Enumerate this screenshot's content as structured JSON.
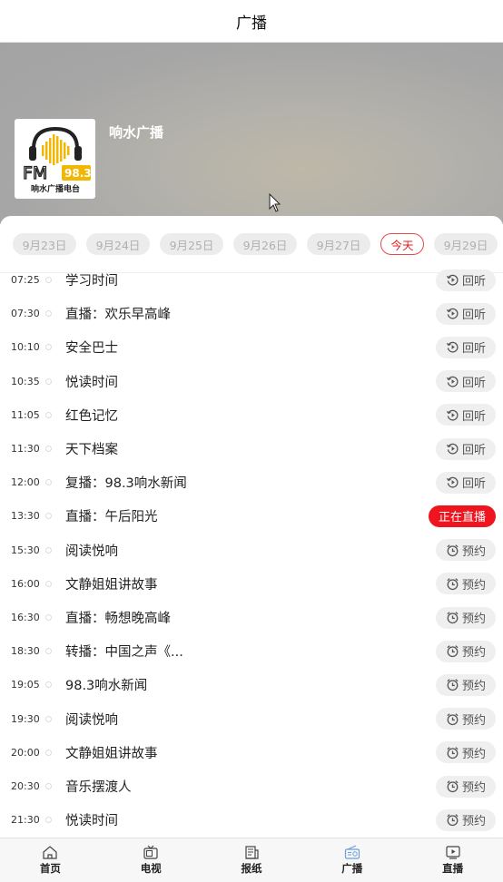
{
  "header": {
    "title": "广播"
  },
  "station": {
    "name": "响水广播",
    "logo_text_fm": "FM",
    "logo_text_freq": "98.3",
    "logo_text_caption": "响水广播电台"
  },
  "dates": [
    {
      "label": "9月23日",
      "active": false
    },
    {
      "label": "9月24日",
      "active": false
    },
    {
      "label": "9月25日",
      "active": false
    },
    {
      "label": "9月26日",
      "active": false
    },
    {
      "label": "9月27日",
      "active": false
    },
    {
      "label": "今天",
      "active": true
    },
    {
      "label": "9月29日",
      "active": false
    }
  ],
  "schedule": [
    {
      "time": "07:25",
      "name": "学习时间",
      "action": "回听",
      "type": "replay"
    },
    {
      "time": "07:30",
      "name": "直播：欢乐早高峰",
      "action": "回听",
      "type": "replay"
    },
    {
      "time": "10:10",
      "name": "安全巴士",
      "action": "回听",
      "type": "replay"
    },
    {
      "time": "10:35",
      "name": "悦读时间",
      "action": "回听",
      "type": "replay"
    },
    {
      "time": "11:05",
      "name": "红色记忆",
      "action": "回听",
      "type": "replay"
    },
    {
      "time": "11:30",
      "name": "天下档案",
      "action": "回听",
      "type": "replay"
    },
    {
      "time": "12:00",
      "name": "复播：98.3响水新闻",
      "action": "回听",
      "type": "replay"
    },
    {
      "time": "13:30",
      "name": "直播：午后阳光",
      "action": "正在直播",
      "type": "live"
    },
    {
      "time": "15:30",
      "name": "阅读悦响",
      "action": "预约",
      "type": "reserve"
    },
    {
      "time": "16:00",
      "name": "文静姐姐讲故事",
      "action": "预约",
      "type": "reserve"
    },
    {
      "time": "16:30",
      "name": "直播：畅想晚高峰",
      "action": "预约",
      "type": "reserve"
    },
    {
      "time": "18:30",
      "name": " 转播：中国之声《...",
      "action": "预约",
      "type": "reserve"
    },
    {
      "time": "19:05",
      "name": "98.3响水新闻",
      "action": "预约",
      "type": "reserve"
    },
    {
      "time": "19:30",
      "name": "阅读悦响",
      "action": "预约",
      "type": "reserve"
    },
    {
      "time": "20:00",
      "name": "文静姐姐讲故事",
      "action": "预约",
      "type": "reserve"
    },
    {
      "time": "20:30",
      "name": "音乐摆渡人",
      "action": "预约",
      "type": "reserve"
    },
    {
      "time": "21:30",
      "name": "悦读时间",
      "action": "预约",
      "type": "reserve"
    }
  ],
  "tabs": [
    {
      "label": "首页",
      "icon": "home-icon",
      "active": false
    },
    {
      "label": "电视",
      "icon": "tv-icon",
      "active": false
    },
    {
      "label": "报纸",
      "icon": "newspaper-icon",
      "active": false
    },
    {
      "label": "广播",
      "icon": "radio-icon",
      "active": true
    },
    {
      "label": "直播",
      "icon": "live-play-icon",
      "active": false
    }
  ],
  "colors": {
    "live": "#f0141e",
    "accent_active_tab": "#6aa0d8",
    "date_active": "#e02020"
  }
}
